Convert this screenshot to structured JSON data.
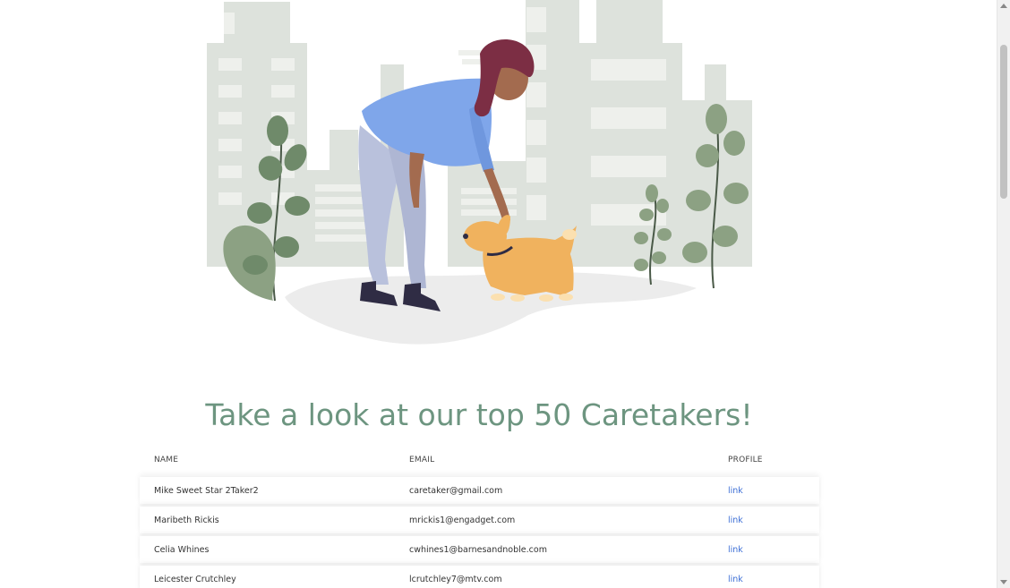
{
  "heading": "Take a look at our top 50 Caretakers!",
  "table": {
    "columns": [
      "NAME",
      "EMAIL",
      "PROFILE"
    ],
    "rows": [
      {
        "name": "Mike Sweet Star 2Taker2",
        "email": "caretaker@gmail.com",
        "profile": "link"
      },
      {
        "name": "Maribeth Rickis",
        "email": "mrickis1@engadget.com",
        "profile": "link"
      },
      {
        "name": "Celia Whines",
        "email": "cwhines1@barnesandnoble.com",
        "profile": "link"
      },
      {
        "name": "Leicester Crutchley",
        "email": "lcrutchley7@mtv.com",
        "profile": "link"
      }
    ]
  },
  "colors": {
    "heading": "#6d9580",
    "link": "#3d6fd6",
    "building": "#dde2dc",
    "leaf": "#6f8a6a",
    "dog": "#f0b25e",
    "shirt": "#7fa6ea",
    "pants": "#b9c1dc"
  }
}
